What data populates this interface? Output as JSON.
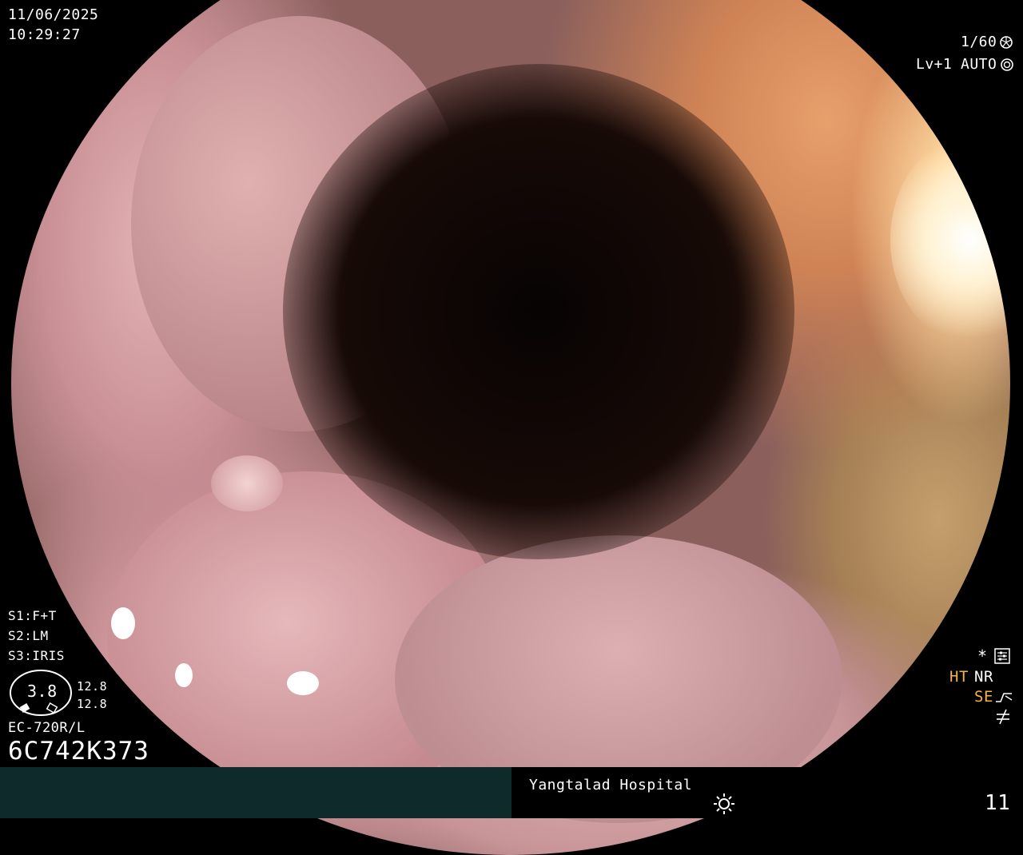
{
  "overlay": {
    "date": "11/06/2025",
    "time": "10:29:27",
    "shutter": "1/60",
    "level": "Lv+1",
    "iris_mode": "AUTO",
    "settings": [
      "S1:F+T",
      "S2:LM",
      "S3:IRIS"
    ],
    "zoom_value": "3.8",
    "scale_top": "12.8",
    "scale_bottom": "12.8",
    "scope_model": "EC-720R/L",
    "scope_serial": "6C742K373",
    "ht_label": "HT",
    "nr_label": "NR",
    "se_label": "SE",
    "hospital": "Yangtalad Hospital",
    "image_number": "11"
  },
  "colors": {
    "ht_color": "#f5b43a",
    "se_color": "#f5b43a",
    "bar_color": "#0f2a2a"
  },
  "icons": [
    "shutter-icon",
    "auto-iris-icon",
    "settings-panel-icon",
    "se-curve-icon",
    "not-equal-icon",
    "light-icon"
  ]
}
